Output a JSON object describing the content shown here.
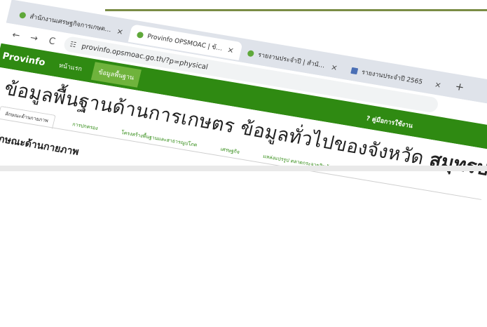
{
  "browser": {
    "tabs": [
      {
        "label": "สำนักงานเศรษฐกิจการเกษตร ข้อมูลพื้นฐาน",
        "icon": "green-circle-favicon"
      },
      {
        "label": "Provinfo OPSMOAC | ข้อมูลพื้นฐาน",
        "icon": "green-circle-favicon"
      },
      {
        "label": "รายงานประจำปี | สำนักงานปลัดกระทรวง",
        "icon": "green-circle-favicon"
      },
      {
        "label": "รายงานประจำปี 2565",
        "icon": "document-favicon"
      }
    ],
    "tab_close": "×",
    "new_tab": "+",
    "url": "provinfo.opsmoac.go.th/?p=physical"
  },
  "sitenav": {
    "brand": "Provinfo",
    "links": [
      "หน้าแรก",
      "ข้อมูลพื้นฐาน"
    ],
    "active_index": 1,
    "help": "? คู่มือการใช้งาน"
  },
  "page": {
    "title_main": "ข้อมูลพื้นฐานด้านการเกษตร ข้อมูลทั่วไปของจังหวัด ",
    "title_province": "สมุทรปราการ",
    "subtabs": [
      "ลักษณะด้านกายภาพ",
      "การปกครอง",
      "โครงสร้างพื้นฐานและสาธารณูปโภค",
      "เศรษฐกิจ",
      "แหล่งแปรรูป ตลาดกระจายสินค้าเกษตร"
    ],
    "section_title": "ลักษณะด้านกายภาพ"
  },
  "colors": {
    "nav_green": "#2f8a12",
    "active_green": "#6fb33c",
    "rule": "#7a8c45"
  }
}
